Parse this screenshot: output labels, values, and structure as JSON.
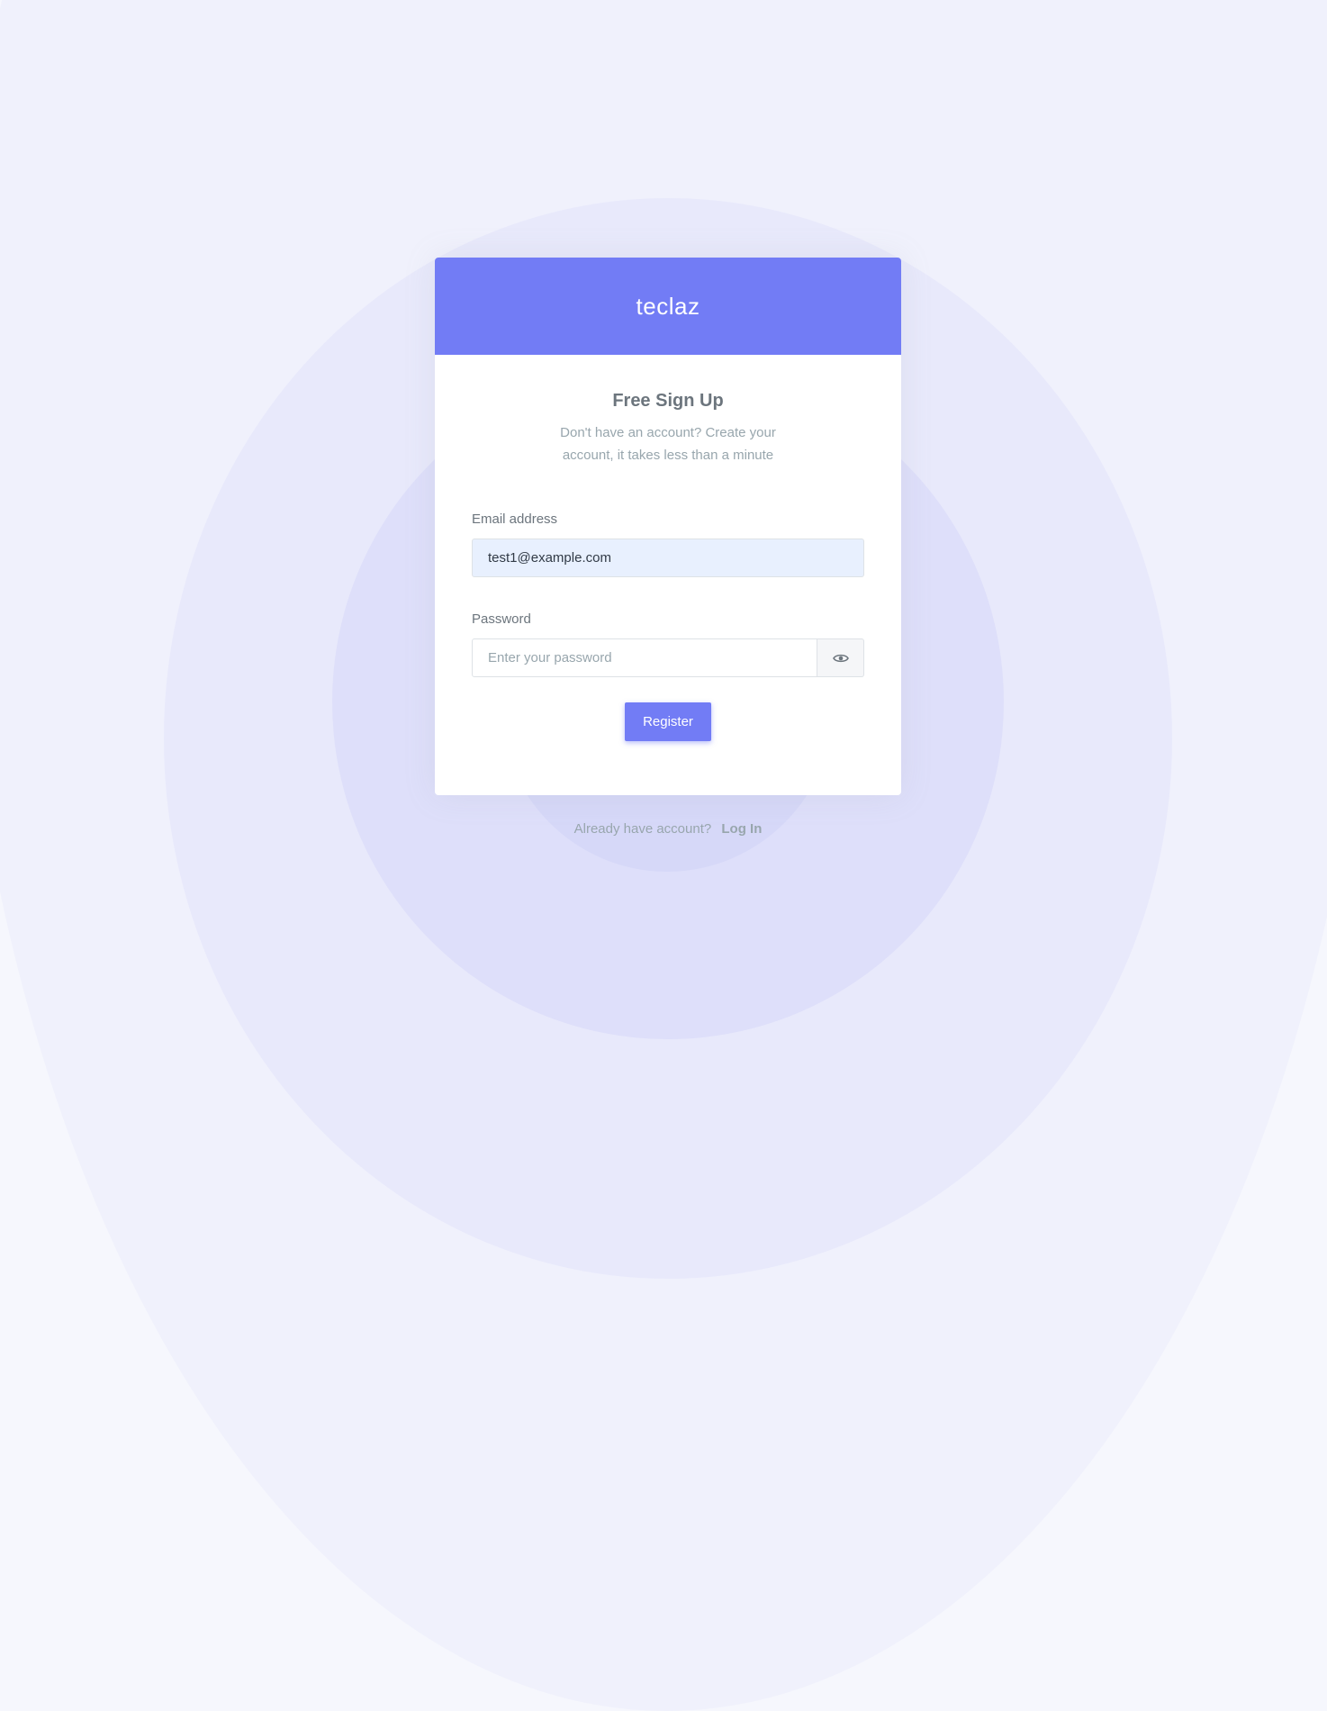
{
  "brand": {
    "name": "teclaz"
  },
  "form": {
    "title": "Free Sign Up",
    "subtitle": "Don't have an account? Create your account, it takes less than a minute",
    "email": {
      "label": "Email address",
      "value": "test1@example.com"
    },
    "password": {
      "label": "Password",
      "placeholder": "Enter your password",
      "value": ""
    },
    "submit_label": "Register"
  },
  "footer": {
    "prompt": "Already have account?",
    "link_label": "Log In"
  },
  "colors": {
    "primary": "#727cf5",
    "muted_text": "#98a6ad",
    "label_text": "#6c757d"
  },
  "icons": {
    "password_toggle": "eye-icon"
  }
}
